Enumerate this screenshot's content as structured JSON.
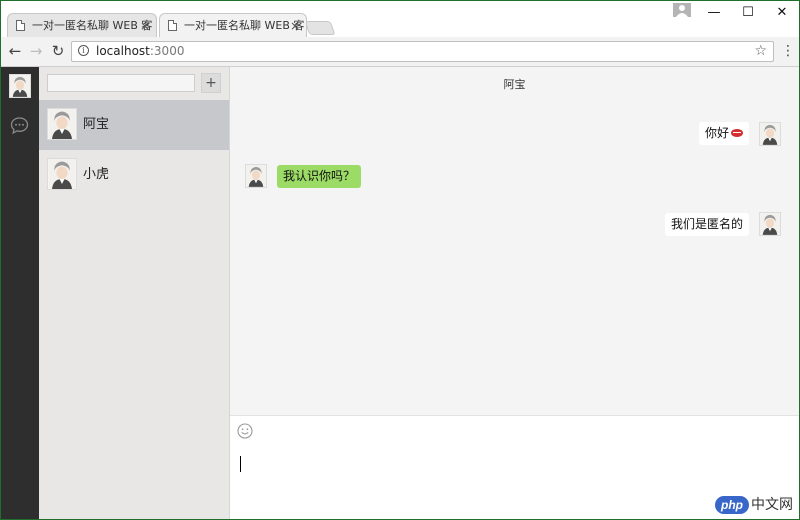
{
  "browser": {
    "tabs": [
      {
        "title": "一对一匿名私聊 WEB 客",
        "active": false
      },
      {
        "title": "一对一匿名私聊 WEB 客",
        "active": true
      }
    ],
    "tab_close_glyph": "×",
    "url_host": "localhost",
    "url_port": ":3000",
    "window_controls": {
      "minimize": "—",
      "maximize": "☐",
      "close": "✕"
    }
  },
  "sidebar": {
    "avatar_icon": "user-avatar-icon",
    "chat_icon": "chat-bubble-icon"
  },
  "contacts": {
    "search_value": "",
    "add_label": "+",
    "items": [
      {
        "name": "阿宝",
        "selected": true
      },
      {
        "name": "小虎",
        "selected": false
      }
    ]
  },
  "chat": {
    "title": "阿宝",
    "messages": [
      {
        "from": "me",
        "text": "你好",
        "emoji": "lips-icon"
      },
      {
        "from": "them",
        "text": "我认识你吗？"
      },
      {
        "from": "me",
        "text": "我们是匿名的"
      }
    ],
    "composer": {
      "emoji_icon": "smiley-icon",
      "input_value": ""
    }
  },
  "watermark": {
    "logo": "php",
    "text": "中文网"
  },
  "colors": {
    "iconbar": "#2e2e2e",
    "contacts_bg": "#e8e7e6",
    "selected_contact": "#c7c8cc",
    "chat_bg": "#f4f4f4",
    "bubble_mine": "#ffffff",
    "bubble_theirs": "#9bdb66"
  }
}
